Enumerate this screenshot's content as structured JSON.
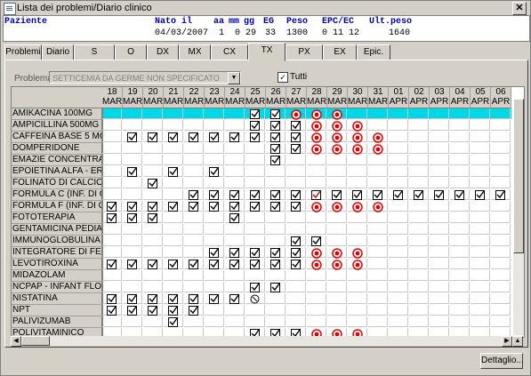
{
  "window": {
    "title": "Lista dei problemi/Diario clinico",
    "close": "✕"
  },
  "patient": {
    "label": "Paziente",
    "nato_label": "Nato il",
    "nato": "04/03/2007",
    "aa_label": "aa",
    "aa": "1",
    "mm_label": "mm",
    "mm": "0",
    "gg_label": "gg",
    "gg": "29",
    "eg_label": "EG",
    "eg": "33",
    "peso_label": "Peso",
    "peso": "1300",
    "epc_label": "EPC/EC",
    "epc": "0 11 12",
    "ultpeso_label": "Ult.peso",
    "ultpeso": "1640"
  },
  "tabs": [
    "Problemi",
    "Diario",
    "S",
    "O",
    "DX",
    "MX",
    "CX",
    "TX",
    "PX",
    "EX",
    "Epic."
  ],
  "active_tab": "TX",
  "problem": {
    "label": "Problema",
    "value": "SETTICEMIA DA GERME NON SPECIFICATO"
  },
  "tutti": {
    "label": "Tutti",
    "checked": true
  },
  "dates": [
    {
      "d": "18",
      "m": "MAR"
    },
    {
      "d": "19",
      "m": "MAR"
    },
    {
      "d": "20",
      "m": "MAR"
    },
    {
      "d": "21",
      "m": "MAR"
    },
    {
      "d": "22",
      "m": "MAR"
    },
    {
      "d": "23",
      "m": "MAR"
    },
    {
      "d": "24",
      "m": "MAR"
    },
    {
      "d": "25",
      "m": "MAR"
    },
    {
      "d": "26",
      "m": "MAR"
    },
    {
      "d": "27",
      "m": "MAR"
    },
    {
      "d": "28",
      "m": "MAR"
    },
    {
      "d": "29",
      "m": "MAR"
    },
    {
      "d": "30",
      "m": "MAR"
    },
    {
      "d": "31",
      "m": "MAR"
    },
    {
      "d": "01",
      "m": "APR"
    },
    {
      "d": "02",
      "m": "APR"
    },
    {
      "d": "03",
      "m": "APR"
    },
    {
      "d": "04",
      "m": "APR"
    },
    {
      "d": "05",
      "m": "APR"
    },
    {
      "d": "06",
      "m": "APR"
    }
  ],
  "rows": [
    {
      "name": "AMIKACINA 100MG",
      "marks": "......."
    },
    {
      "name": "AMPICILLINA 500MG"
    },
    {
      "name": "CAFFEINA BASE 5 MG"
    },
    {
      "name": "DOMPERIDONE"
    },
    {
      "name": "EMAZIE CONCENTRATE"
    },
    {
      "name": "EPOIETINA ALFA - ERI"
    },
    {
      "name": "FOLINATO DI CALCIO"
    },
    {
      "name": "FORMULA C (INF. DI GI"
    },
    {
      "name": "FORMULA F (INF. DI GI"
    },
    {
      "name": "FOTOTERAPIA"
    },
    {
      "name": "GENTAMICINA PEDIAT"
    },
    {
      "name": "IMMUNOGLOBULINA U"
    },
    {
      "name": "INTEGRATORE DI FER"
    },
    {
      "name": "LEVOTIROXINA"
    },
    {
      "name": "MIDAZOLAM"
    },
    {
      "name": "NCPAP - INFANT FLOW"
    },
    {
      "name": "NISTATINA"
    },
    {
      "name": "NPT"
    },
    {
      "name": "PALIVIZUMAB"
    },
    {
      "name": "POLIVITAMINICO"
    }
  ],
  "detail_button": "Dettaglio..."
}
